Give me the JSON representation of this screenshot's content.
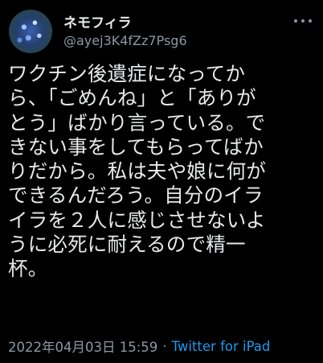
{
  "author": {
    "display_name": "ネモフィラ",
    "handle": "@ayej3K4fZz7Psg6"
  },
  "tweet": {
    "lines": [
      "ワクチン後遺症になってか",
      "ら、「ごめんね」と「ありが",
      "とう」ばかり言っている。で",
      "きない事をしてもらってばか",
      "りだから。私は夫や娘に何が",
      "できるんだろう。自分のイラ",
      "イラを２人に感じさせないよ",
      "うに必死に耐えるので精一",
      "杯。"
    ],
    "timestamp": "2022年04月03日 15:59",
    "separator": "·",
    "source": "Twitter for iPad"
  },
  "icons": {
    "avatar": "nemophila-flowers-avatar",
    "more": "more-options-icon"
  },
  "colors": {
    "background": "#000000",
    "text": "#e7e9ea",
    "muted": "#8b98a5",
    "link": "#1d9bf0"
  }
}
